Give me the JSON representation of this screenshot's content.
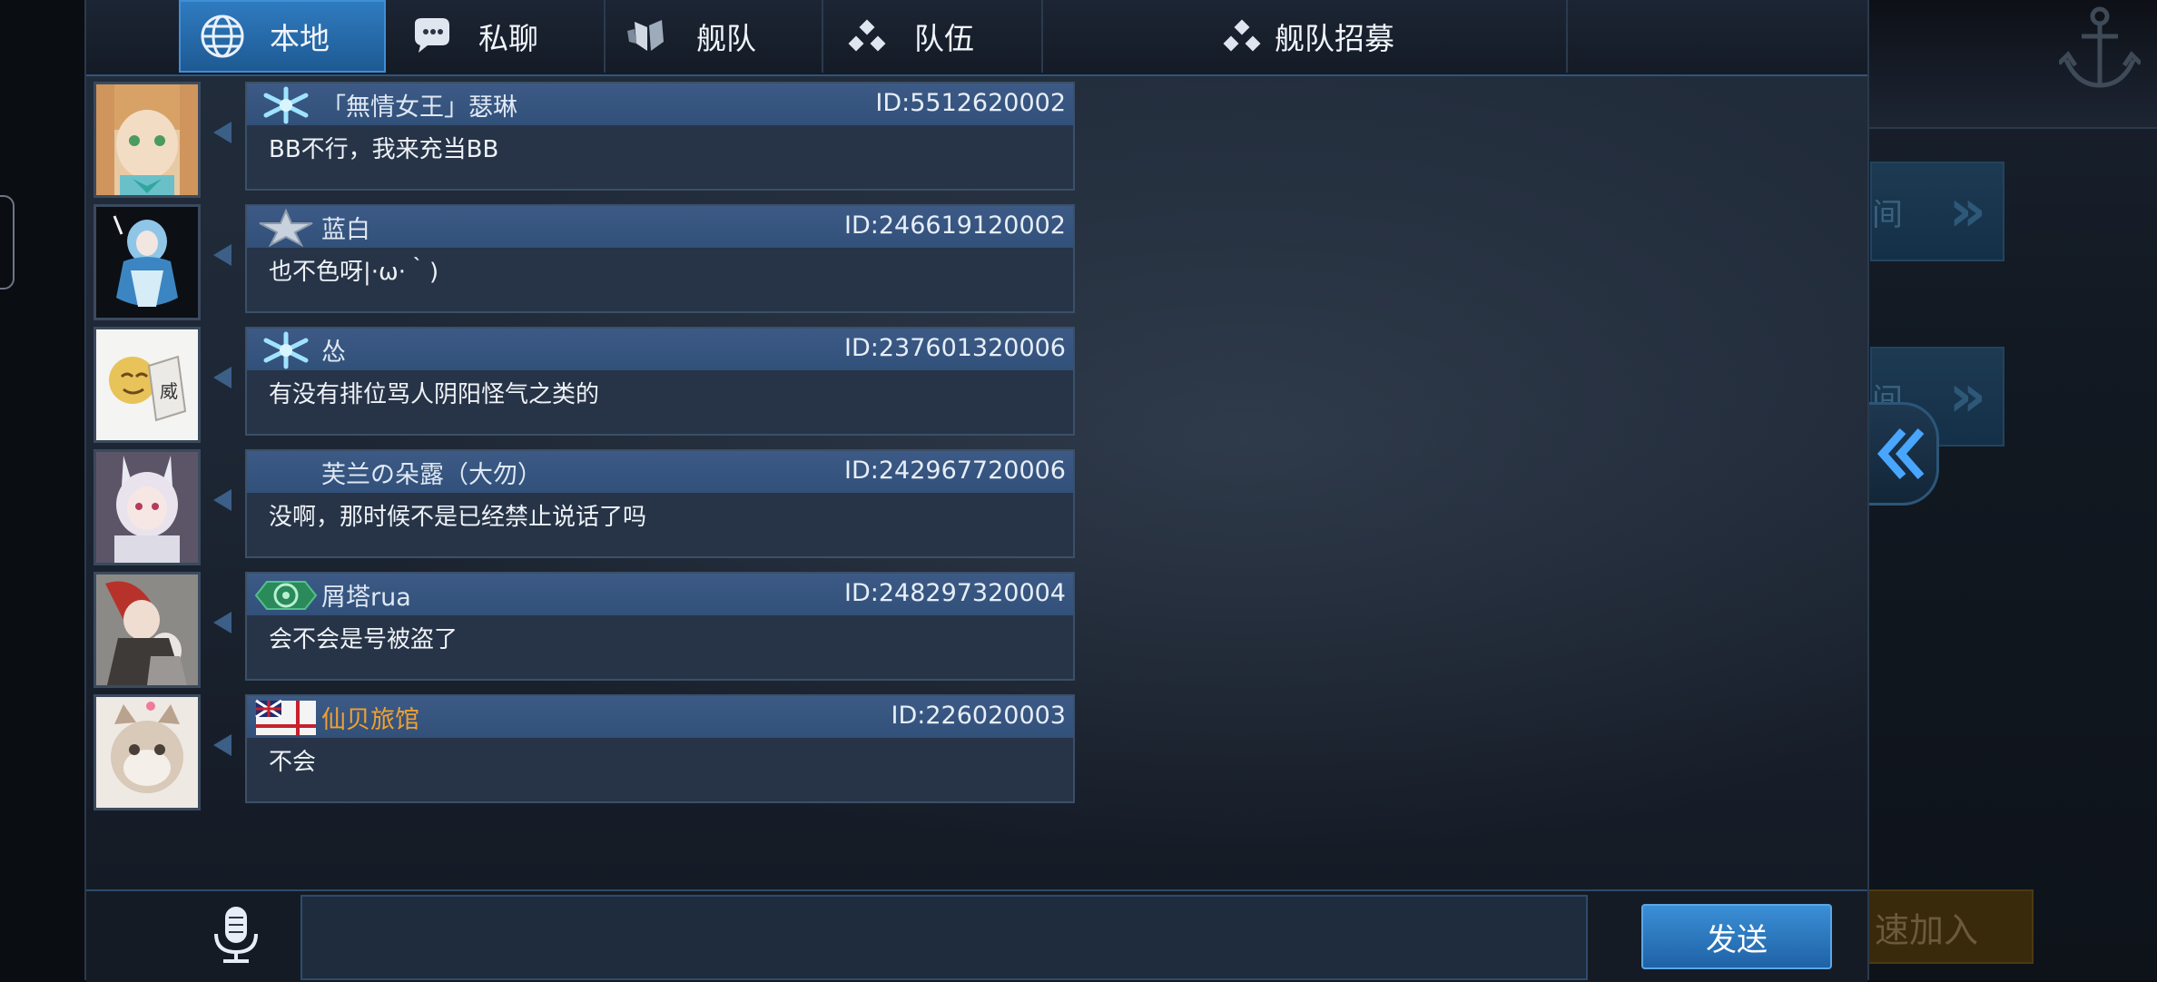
{
  "tabs": [
    {
      "label": "本地",
      "icon": "globe-icon",
      "active": true
    },
    {
      "label": "私聊",
      "icon": "chat-bubble-icon",
      "active": false
    },
    {
      "label": "舰队",
      "icon": "fleet-icon",
      "active": false
    },
    {
      "label": "队伍",
      "icon": "team-dots-icon",
      "active": false
    },
    {
      "label": "舰队招募",
      "icon": "team-dots-icon",
      "active": false
    }
  ],
  "messages": [
    {
      "name": "「無情女王」瑟琳",
      "id": "ID:5512620002",
      "text": "BB不行，我来充当BB",
      "badge": "snowflake-badge-icon"
    },
    {
      "name": "蓝白",
      "id": "ID:246619120002",
      "text": "也不色呀|·ω·｀)",
      "badge": "star-badge-icon"
    },
    {
      "name": "怂",
      "id": "ID:237601320006",
      "text": "有没有排位骂人阴阳怪气之类的",
      "badge": "snowflake-badge-icon"
    },
    {
      "name": "芙兰の朵露（大勿）",
      "id": "ID:242967720006",
      "text": "没啊，那时候不是已经禁止说话了吗",
      "badge": ""
    },
    {
      "name": "屑塔rua",
      "id": "ID:248297320004",
      "text": "会不会是号被盗了",
      "badge": "green-emblem-badge-icon"
    },
    {
      "name": "仙贝旅馆",
      "id": "ID:226020003",
      "text": "不会",
      "badge": "naval-flag-badge-icon",
      "name_color": "#f0a030"
    }
  ],
  "input": {
    "placeholder": "",
    "value": ""
  },
  "send_label": "发送",
  "background_ui": {
    "button_fragment_1": "间",
    "button_fragment_2": "间",
    "quick_join_fragment": "速加入"
  },
  "colors": {
    "active_tab": "#2f7bc0",
    "bubble_header": "#3c5a85",
    "accent_orange": "#f0a030"
  }
}
